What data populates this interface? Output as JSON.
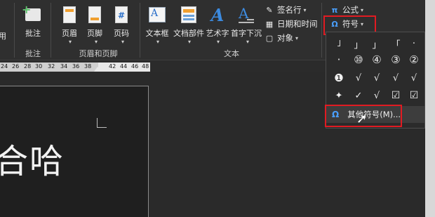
{
  "ribbon": {
    "partial_left_label": "用",
    "comment": {
      "label": "批注",
      "group": "批注"
    },
    "header_footer": {
      "header": "页眉",
      "footer": "页脚",
      "page_number": "页码",
      "page_number_glyph": "#",
      "group": "页眉和页脚"
    },
    "text": {
      "textbox": "文本框",
      "textbox_glyph": "A",
      "doc_parts": "文档部件",
      "wordart": "艺术字",
      "wordart_glyph": "A",
      "dropcap": "首字下沉",
      "dropcap_glyph": "A",
      "signature": "签名行",
      "datetime": "日期和时间",
      "object": "对象",
      "group": "文本"
    },
    "symbols": {
      "equation": "公式",
      "equation_glyph": "π",
      "symbol": "符号",
      "symbol_glyph": "Ω"
    }
  },
  "ruler": {
    "ticks": [
      "24",
      "26",
      "28",
      "30",
      "32",
      "34",
      "36",
      "38",
      "42",
      "44",
      "46",
      "48"
    ]
  },
  "symbol_panel": {
    "rows": [
      [
        "˩",
        "」",
        "」",
        "「",
        "·"
      ],
      [
        "·",
        "⑩",
        "④",
        "③",
        "②"
      ],
      [
        "❶",
        "√",
        "√",
        "√",
        "√"
      ],
      [
        "✦",
        "✓",
        "√",
        "☑",
        "☑"
      ]
    ],
    "more_symbols": "其他符号(M)..."
  },
  "document": {
    "text": "合哈"
  },
  "colors": {
    "accent": "#4aa0ff",
    "highlight_border": "#e11b22",
    "ribbon_bg": "#2f2f2f",
    "canvas_bg": "#2a2a2a"
  },
  "icons": {
    "comment": "comment-add-icon",
    "header": "header-icon",
    "footer": "footer-icon",
    "page_number": "page-number-icon",
    "textbox": "textbox-icon",
    "doc_parts": "quick-parts-icon",
    "wordart": "wordart-icon",
    "dropcap": "dropcap-icon",
    "signature": "signature-line-icon",
    "datetime": "date-time-icon",
    "object": "object-icon",
    "equation": "pi-icon",
    "symbol": "omega-icon"
  }
}
